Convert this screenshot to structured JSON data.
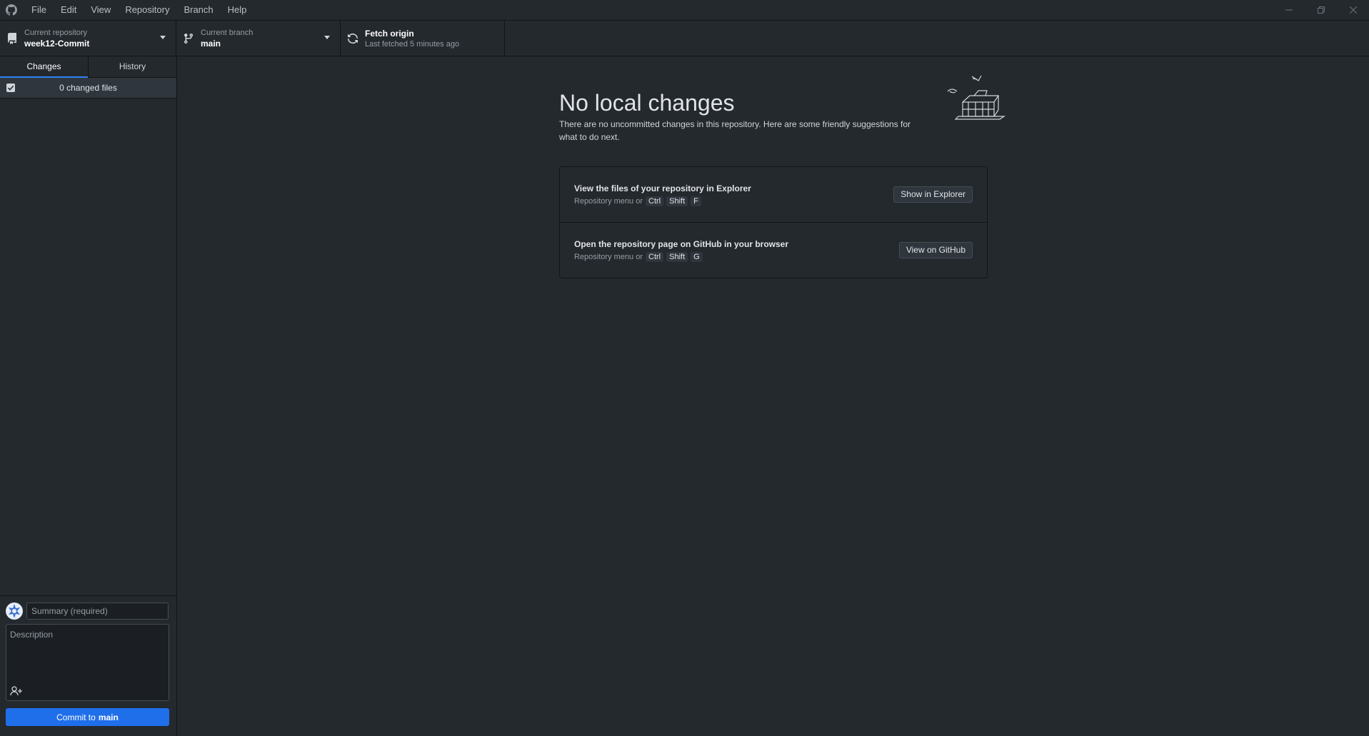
{
  "menu": [
    "File",
    "Edit",
    "View",
    "Repository",
    "Branch",
    "Help"
  ],
  "toolbar": {
    "repo_label": "Current repository",
    "repo_value": "week12-Commit",
    "branch_label": "Current branch",
    "branch_value": "main",
    "fetch_title": "Fetch origin",
    "fetch_sub": "Last fetched 5 minutes ago"
  },
  "sidebar": {
    "tabs": [
      {
        "label": "Changes",
        "selected": true
      },
      {
        "label": "History",
        "selected": false
      }
    ],
    "changed_files": "0 changed files",
    "summary_placeholder": "Summary (required)",
    "description_placeholder": "Description",
    "commit_prefix": "Commit to",
    "commit_branch": "main"
  },
  "main": {
    "heading": "No local changes",
    "subtext": "There are no uncommitted changes in this repository. Here are some friendly suggestions for what to do next.",
    "actions": [
      {
        "title": "View the files of your repository in Explorer",
        "hint_prefix": "Repository menu or",
        "keys": [
          "Ctrl",
          "Shift",
          "F"
        ],
        "button": "Show in Explorer"
      },
      {
        "title": "Open the repository page on GitHub in your browser",
        "hint_prefix": "Repository menu or",
        "keys": [
          "Ctrl",
          "Shift",
          "G"
        ],
        "button": "View on GitHub"
      }
    ]
  },
  "colors": {
    "background": "#24292e",
    "accent": "#1f6feb",
    "tab_underline": "#2f81f7"
  }
}
